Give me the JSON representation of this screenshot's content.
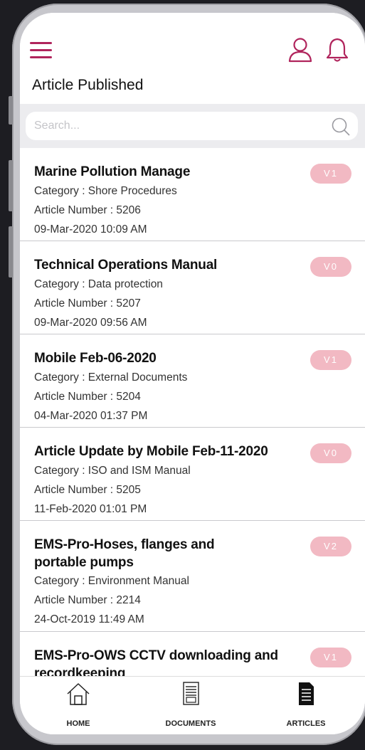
{
  "header": {
    "title": "Article Published"
  },
  "search": {
    "placeholder": "Search..."
  },
  "articles": [
    {
      "title": "Marine Pollution Manage",
      "category": "Category : Shore Procedures",
      "number": "Article Number : 5206",
      "date": "09-Mar-2020 10:09  AM",
      "version": "V1"
    },
    {
      "title": "Technical Operations Manual",
      "category": "Category : Data protection",
      "number": "Article Number : 5207",
      "date": "09-Mar-2020 09:56  AM",
      "version": "V0"
    },
    {
      "title": "Mobile Feb-06-2020",
      "category": "Category : External Documents",
      "number": "Article Number : 5204",
      "date": "04-Mar-2020 01:37  PM",
      "version": "V1"
    },
    {
      "title": "Article Update by Mobile Feb-11-2020",
      "category": "Category : ISO and ISM Manual",
      "number": "Article Number : 5205",
      "date": "11-Feb-2020 01:01  PM",
      "version": "V0"
    },
    {
      "title": "EMS-Pro-Hoses, flanges and portable pumps",
      "category": "Category : Environment Manual",
      "number": "Article Number : 2214",
      "date": "24-Oct-2019 11:49  AM",
      "version": "V2"
    },
    {
      "title": "EMS-Pro-OWS CCTV downloading and recordkeeping",
      "category": "",
      "number": "",
      "date": "",
      "version": "V1"
    }
  ],
  "tabs": [
    {
      "label": "HOME",
      "icon": "home-icon"
    },
    {
      "label": "DOCUMENTS",
      "icon": "documents-icon"
    },
    {
      "label": "ARTICLES",
      "icon": "articles-icon"
    }
  ],
  "colors": {
    "accent": "#b0245c",
    "badge": "#f2b9c3",
    "background": "#ececef"
  }
}
